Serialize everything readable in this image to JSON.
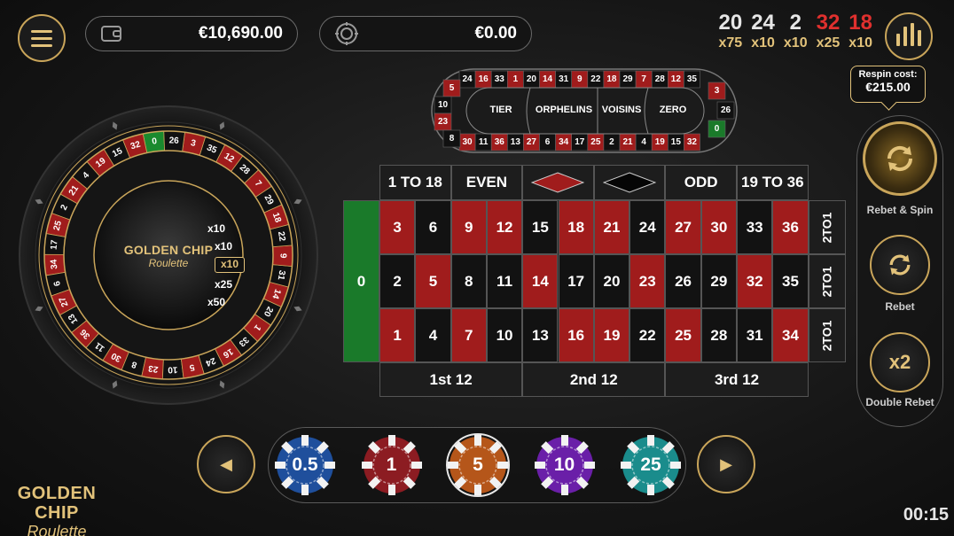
{
  "header": {
    "balance": "€10,690.00",
    "bet_total": "€0.00"
  },
  "history": [
    {
      "number": "20",
      "multiplier": "x75",
      "color": "#e6e6e6"
    },
    {
      "number": "24",
      "multiplier": "x10",
      "color": "#e6e6e6"
    },
    {
      "number": "2",
      "multiplier": "x10",
      "color": "#e6e6e6"
    },
    {
      "number": "32",
      "multiplier": "x25",
      "color": "#e0302e"
    },
    {
      "number": "18",
      "multiplier": "x10",
      "color": "#e0302e"
    }
  ],
  "respin": {
    "label": "Respin cost:",
    "value": "€215.00"
  },
  "side_panel": {
    "rebet_spin_label": "Rebet & Spin",
    "rebet_label": "Rebet",
    "double_rebet_label": "Double Rebet",
    "double_rebet_icon_text": "x2"
  },
  "wheel": {
    "logo_line1": "GOLDEN CHIP",
    "logo_line2": "Roulette",
    "multipliers": [
      "x10",
      "x10",
      "x10",
      "x25",
      "x50"
    ],
    "numbers": [
      "0",
      "32",
      "15",
      "19",
      "4",
      "21",
      "2",
      "25",
      "17",
      "34",
      "6",
      "27",
      "13",
      "36",
      "11",
      "30",
      "8",
      "23",
      "10",
      "5",
      "24",
      "16",
      "33",
      "1",
      "20",
      "14",
      "31",
      "9",
      "22",
      "18",
      "29",
      "7",
      "28",
      "12",
      "35",
      "3",
      "26"
    ]
  },
  "racetrack": {
    "top_row": [
      "24",
      "16",
      "33",
      "1",
      "20",
      "14",
      "31",
      "9",
      "22",
      "18",
      "29",
      "7",
      "28",
      "12",
      "35"
    ],
    "bottom_row": [
      "30",
      "11",
      "36",
      "13",
      "27",
      "6",
      "34",
      "17",
      "25",
      "2",
      "21",
      "4",
      "19",
      "15",
      "32"
    ],
    "left_curve": [
      "5",
      "10",
      "23",
      "8"
    ],
    "right_curve": [
      "3",
      "26",
      "0"
    ],
    "sections": [
      "TIER",
      "ORPHELINS",
      "VOISINS",
      "ZERO"
    ]
  },
  "table": {
    "zero": "0",
    "top_bets": [
      "1 TO 18",
      "EVEN",
      "",
      "",
      "ODD",
      "19 TO 36"
    ],
    "row_top": [
      "3",
      "6",
      "9",
      "12",
      "15",
      "18",
      "21",
      "24",
      "27",
      "30",
      "33",
      "36"
    ],
    "row_mid": [
      "2",
      "5",
      "8",
      "11",
      "14",
      "17",
      "20",
      "23",
      "26",
      "29",
      "32",
      "35"
    ],
    "row_bot": [
      "1",
      "4",
      "7",
      "10",
      "13",
      "16",
      "19",
      "22",
      "25",
      "28",
      "31",
      "34"
    ],
    "columns": [
      "2TO1",
      "2TO1",
      "2TO1"
    ],
    "dozens": [
      "1st 12",
      "2nd 12",
      "3rd 12"
    ],
    "red_numbers": [
      "1",
      "3",
      "5",
      "7",
      "9",
      "12",
      "14",
      "16",
      "18",
      "19",
      "21",
      "23",
      "25",
      "27",
      "30",
      "32",
      "34",
      "36"
    ]
  },
  "chips": [
    {
      "label": "0.5",
      "color": "#1f4f9c",
      "selected": false
    },
    {
      "label": "1",
      "color": "#8c1c22",
      "selected": false
    },
    {
      "label": "5",
      "color": "#b5561a",
      "selected": true
    },
    {
      "label": "10",
      "color": "#6a1fa8",
      "selected": false
    },
    {
      "label": "25",
      "color": "#1a8c8c",
      "selected": false
    }
  ],
  "logo": {
    "line1": "GOLDEN CHIP",
    "line2": "Roulette"
  },
  "timer": "00:15"
}
